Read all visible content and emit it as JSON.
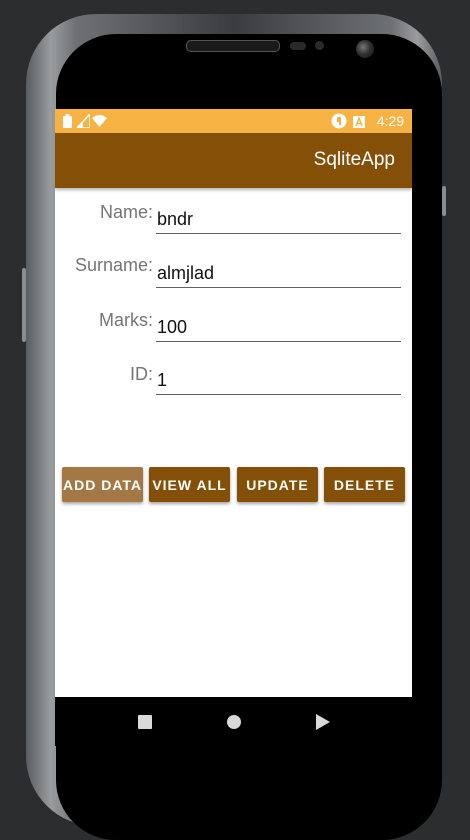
{
  "status_bar": {
    "time": "4:29"
  },
  "app_bar": {
    "title": "SqliteApp"
  },
  "form": {
    "name_label": "Name:",
    "name_value": "bndr",
    "surname_label": "Surname:",
    "surname_value": "almjlad",
    "marks_label": "Marks:",
    "marks_value": "100",
    "id_label": "ID:",
    "id_value": "1"
  },
  "buttons": {
    "add": "ADD DATA",
    "view": "VIEW ALL",
    "update": "UPDATE",
    "delete": "DELETE"
  },
  "colors": {
    "status_bar": "#f7b244",
    "app_bar": "#844f07",
    "button": "#844f07",
    "button_pressed": "#a47844"
  },
  "icons": [
    "battery-icon",
    "signal-icon",
    "wifi-icon",
    "notification-icon",
    "storage-icon",
    "back-icon",
    "home-icon",
    "recent-apps-icon"
  ]
}
